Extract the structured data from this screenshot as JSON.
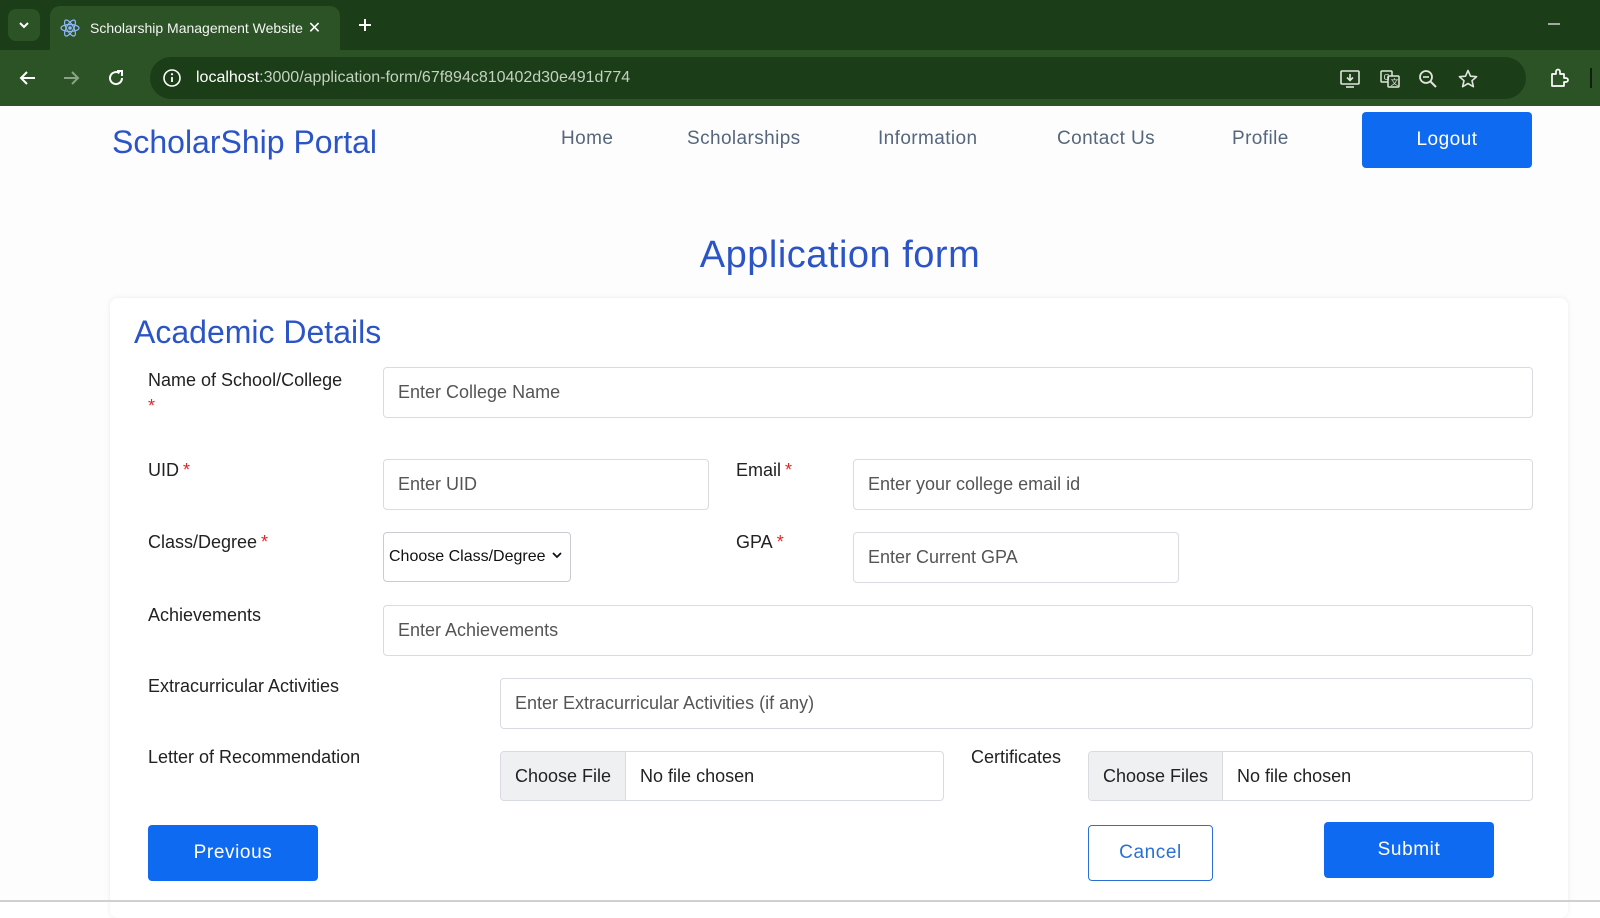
{
  "browser": {
    "tab_title": "Scholarship Management Website",
    "url_host": "localhost",
    "url_path": ":3000/application-form/67f894c810402d30e491d774",
    "icons": [
      "tab-list-icon",
      "react-favicon-icon",
      "close-icon",
      "plus-icon",
      "minimize-icon",
      "back-arrow-icon",
      "forward-arrow-icon",
      "reload-icon",
      "info-icon",
      "install-app-icon",
      "translate-icon",
      "zoom-icon",
      "bookmark-star-icon",
      "extensions-icon"
    ]
  },
  "navbar": {
    "brand": "ScholarShip Portal",
    "links": [
      "Home",
      "Scholarships",
      "Information",
      "Contact Us",
      "Profile"
    ],
    "logout_label": "Logout"
  },
  "form": {
    "title": "Application form",
    "section_title": "Academic Details",
    "required_mark": "*",
    "college": {
      "label": "Name of School/College",
      "placeholder": "Enter College Name",
      "value": ""
    },
    "uid": {
      "label": "UID",
      "placeholder": "Enter UID",
      "value": ""
    },
    "email": {
      "label": "Email",
      "placeholder": "Enter your college email id",
      "value": ""
    },
    "degree": {
      "label": "Class/Degree",
      "selected": "Choose Class/Degree"
    },
    "gpa": {
      "label": "GPA",
      "placeholder": "Enter Current GPA",
      "value": ""
    },
    "achievements": {
      "label": "Achievements",
      "placeholder": "Enter Achievements",
      "value": ""
    },
    "extracurricular": {
      "label": "Extracurricular Activities",
      "placeholder": "Enter Extracurricular Activities (if any)",
      "value": ""
    },
    "recommendation": {
      "label": "Letter of Recommendation",
      "button": "Choose File",
      "status": "No file chosen"
    },
    "certificates": {
      "label": "Certificates",
      "button": "Choose Files",
      "status": "No file chosen"
    },
    "buttons": {
      "previous": "Previous",
      "cancel": "Cancel",
      "submit": "Submit"
    }
  },
  "colors": {
    "accent": "#0f6af2",
    "heading": "#2b55c7",
    "required": "#e0262b",
    "chrome": "#2c5326"
  }
}
